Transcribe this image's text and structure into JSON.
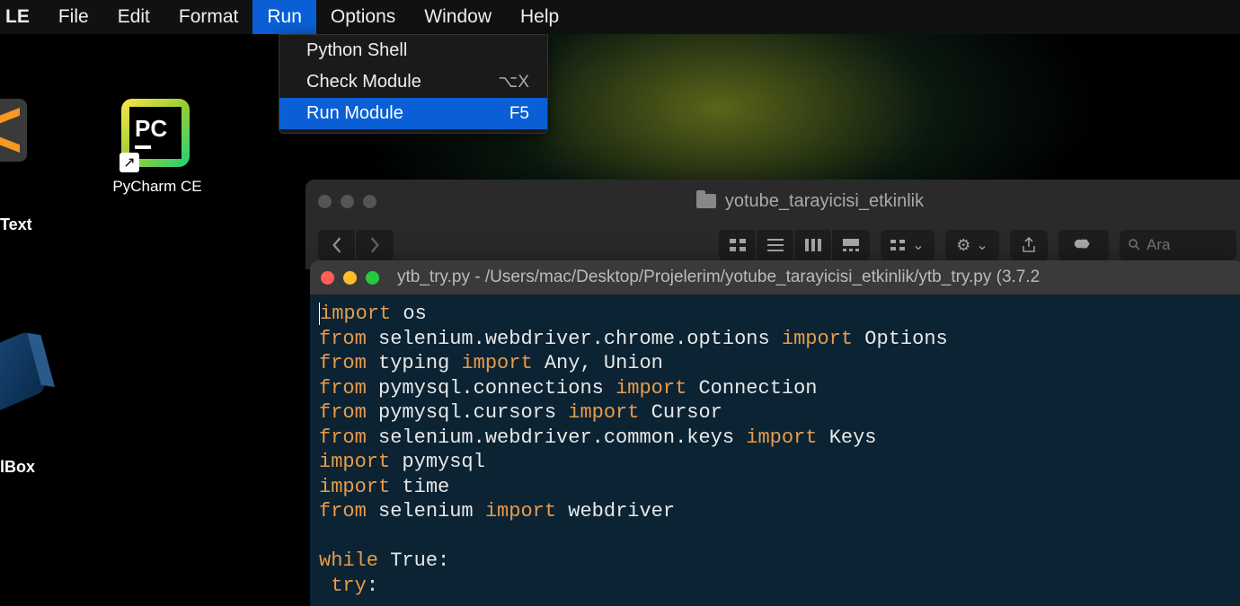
{
  "menubar": {
    "app": "LE",
    "items": [
      "File",
      "Edit",
      "Format",
      "Run",
      "Options",
      "Window",
      "Help"
    ],
    "active_index": 3
  },
  "dropdown": {
    "items": [
      {
        "label": "Python Shell",
        "shortcut": ""
      },
      {
        "label": "Check Module",
        "shortcut": "⌥X"
      },
      {
        "label": "Run Module",
        "shortcut": "F5"
      }
    ],
    "highlight_index": 2
  },
  "desktop": {
    "pycharm_label": "PyCharm CE",
    "sublime_label": "Text",
    "vbox_label": "lBox"
  },
  "finder": {
    "title": "yotube_tarayicisi_etkinlik",
    "search_placeholder": "Ara"
  },
  "idle": {
    "title": "ytb_try.py - /Users/mac/Desktop/Projelerim/yotube_tarayicisi_etkinlik/ytb_try.py (3.7.2"
  },
  "code": {
    "l1a": "import",
    "l1b": " os",
    "l2a": "from",
    "l2b": " selenium.webdriver.chrome.options ",
    "l2c": "import",
    "l2d": " Options",
    "l3a": "from",
    "l3b": " typing ",
    "l3c": "import",
    "l3d": " Any, Union",
    "l4a": "from",
    "l4b": " pymysql.connections ",
    "l4c": "import",
    "l4d": " Connection",
    "l5a": "from",
    "l5b": " pymysql.cursors ",
    "l5c": "import",
    "l5d": " Cursor",
    "l6a": "from",
    "l6b": " selenium.webdriver.common.keys ",
    "l6c": "import",
    "l6d": " Keys",
    "l7a": "import",
    "l7b": " pymysql",
    "l8a": "import",
    "l8b": " time",
    "l9a": "from",
    "l9b": " selenium ",
    "l9c": "import",
    "l9d": " webdriver",
    "l10": "",
    "l11a": "while",
    "l11b": " True:",
    "l12a": " ",
    "l12b": "try",
    "l12c": ":"
  }
}
